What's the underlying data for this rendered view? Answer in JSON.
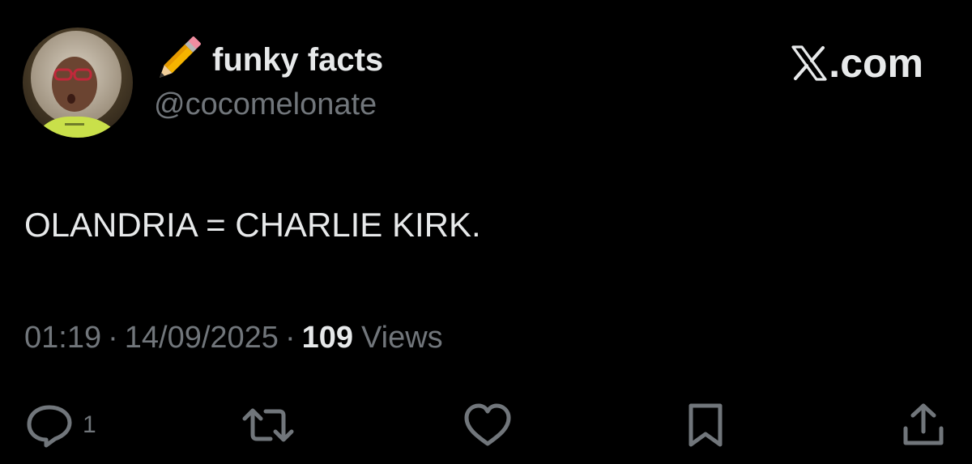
{
  "author": {
    "emoji_icon": "pencil-emoji",
    "display_name": "funky facts",
    "handle": "@cocomelonate"
  },
  "brand": {
    "icon": "x-logo-icon",
    "text": ".com"
  },
  "tweet": {
    "text": "OLANDRIA = CHARLIE KIRK."
  },
  "meta": {
    "time": "01:19",
    "separator": "·",
    "date": "14/09/2025",
    "views_count": "109",
    "views_label": "Views"
  },
  "actions": {
    "reply_count": "1",
    "icons": [
      "reply-icon",
      "retweet-icon",
      "like-icon",
      "bookmark-icon",
      "share-icon"
    ]
  },
  "colors": {
    "background": "#000000",
    "primary_text": "#e7e9ea",
    "secondary_text": "#71767b"
  }
}
